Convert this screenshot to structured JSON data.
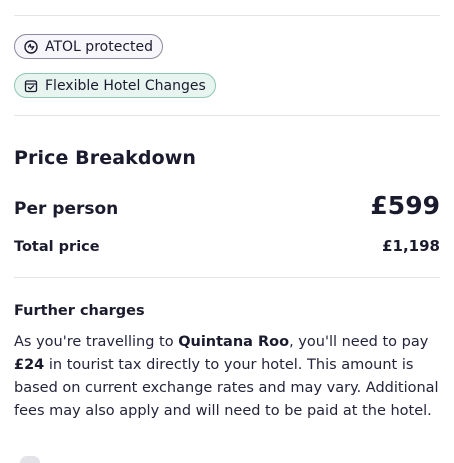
{
  "badges": {
    "atol": {
      "label": "ATOL protected",
      "icon": "atol-shield-icon"
    },
    "flex": {
      "label": "Flexible Hotel Changes",
      "icon": "calendar-check-icon"
    }
  },
  "price": {
    "title": "Price Breakdown",
    "per_person_label": "Per person",
    "per_person_value": "£599",
    "total_label": "Total price",
    "total_value": "£1,198"
  },
  "further": {
    "title": "Further charges",
    "text_1": "As you're travelling to ",
    "destination": "Quintana Roo",
    "text_2": ", you'll need to pay ",
    "amount": "£24",
    "text_3": " in tourist tax directly to your hotel. This amount is based on current exchange rates and may vary. Additional fees may also apply and will need to be paid at the hotel."
  },
  "colors": {
    "text": "#1b1b2e",
    "flex_badge_bg": "#e8f4ef",
    "flex_badge_border": "#8fc7b2",
    "atol_badge_border": "#8d8a9c"
  }
}
